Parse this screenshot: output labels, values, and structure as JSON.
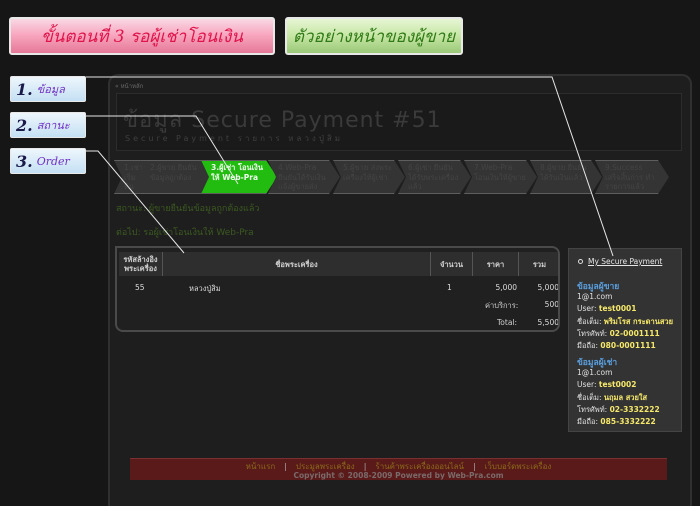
{
  "banners": {
    "step": "ขั้นตอนที่ 3  รอผู้เช่าโอนเงิน",
    "sample": "ตัวอย่างหน้าของผู้ขาย"
  },
  "tags": [
    {
      "num": "1.",
      "label": "ข้อมูล"
    },
    {
      "num": "2.",
      "label": "สถานะ"
    },
    {
      "num": "3.",
      "label": "Order"
    }
  ],
  "page": {
    "breadcrumb": "« หน้าหลัก",
    "title": "ข้อมูล Secure Payment #51",
    "subtitle": "Secure Payment รายการ หลวงปู่สิม"
  },
  "steps": [
    {
      "label": "1.เช่า เริ่มต้น"
    },
    {
      "label": "2.ผู้ขาย ยืนยันข้อมูลถูกต้อง"
    },
    {
      "label": "3.ผู้เช่า โอนเงินให้ Web-Pra",
      "active": true
    },
    {
      "label": "4.Web-Pra ยืนยันได้รับเงิน แจ้งผู้ขายส่งพระ"
    },
    {
      "label": "5.ผู้ขาย ส่งพระเครื่องให้ผู้เช่า"
    },
    {
      "label": "6.ผู้เช่า ยืนยันได้รับพระเครื่องแล้ว"
    },
    {
      "label": "7.Web-Pra โอนเงินให้ผู้ขาย"
    },
    {
      "label": "8.ผู้ขาย ยืนยันได้รับเงินแล้ว"
    },
    {
      "label": "9.Success เสร็จสิ้นการ ทำรายการแล้ว"
    }
  ],
  "status": "สถานะ: ผู้ขายยืนยันข้อมูลถูกต้องแล้ว",
  "next": "ต่อไป: รอผู้เช่าโอนเงินให้ Web-Pra",
  "order": {
    "headers": [
      "รหัสล้างอิง พระเครื่อง",
      "ชื่อพระเครื่อง",
      "จำนวน",
      "ราคา",
      "รวม"
    ],
    "rows": [
      {
        "id": "55",
        "name": "หลวงปู่สิม",
        "qty": "1",
        "price": "5,000",
        "total": "5,000"
      }
    ],
    "service_label": "ค่าบริการ:",
    "service_value": "500",
    "total_label": "Total:",
    "total_value": "5,500"
  },
  "side": {
    "link": "My Secure Payment",
    "seller_heading": "ข้อมูลผู้ขาย",
    "seller_email": "1@1.com",
    "seller_user_label": "User:",
    "seller_user": "test0001",
    "seller_name_label": "ชื่อเต็ม:",
    "seller_name": "พริมโรส กระดานสวย",
    "seller_phone_label": "โทรศัพท์:",
    "seller_phone": "02-0001111",
    "seller_mobile_label": "มือถือ:",
    "seller_mobile": "080-0001111",
    "buyer_heading": "ข้อมูลผู้เช่า",
    "buyer_email": "1@1.com",
    "buyer_user_label": "User:",
    "buyer_user": "test0002",
    "buyer_name_label": "ชื่อเต็ม:",
    "buyer_name": "นฤมล สวยใส",
    "buyer_phone_label": "โทรศัพท์:",
    "buyer_phone": "02-3332222",
    "buyer_mobile_label": "มือถือ:",
    "buyer_mobile": "085-3332222"
  },
  "footer": {
    "links": [
      "หน้าแรก",
      "ประมูลพระเครื่อง",
      "ร้านค้าพระเครื่องออนไลน์",
      "เว็บบอร์ดพระเครื่อง"
    ],
    "copyright": "Copyright © 2008-2009 Powered by Web-Pra.com"
  }
}
